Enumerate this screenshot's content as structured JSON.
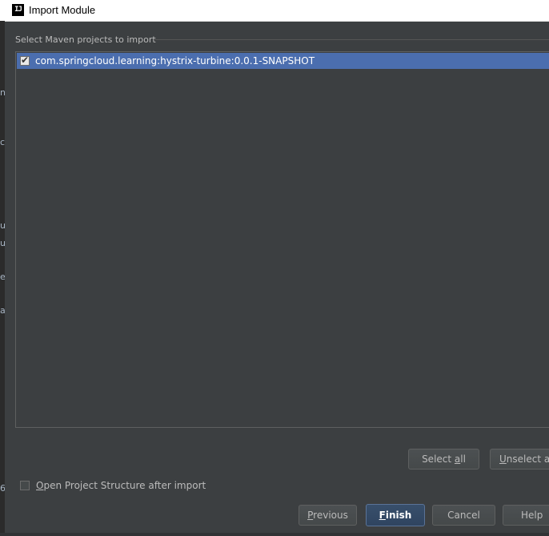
{
  "window": {
    "title": "Import Module",
    "app_icon_text": "IJ"
  },
  "background_fragments": [
    "ni",
    "c",
    "u",
    "u",
    "e",
    "al",
    "6"
  ],
  "section": {
    "title": "Select Maven projects to import"
  },
  "projects": [
    {
      "label": "com.springcloud.learning:hystrix-turbine:0.0.1-SNAPSHOT",
      "checked": true,
      "selected": true
    }
  ],
  "selection_buttons": {
    "select_all_pre": "Select ",
    "select_all_mnemonic": "a",
    "select_all_post": "ll",
    "unselect_all_mnemonic": "U",
    "unselect_all_post": "nselect al"
  },
  "options": {
    "open_structure_mnemonic": "O",
    "open_structure_rest": "pen Project Structure after import",
    "open_structure_checked": false
  },
  "footer": {
    "previous_mnemonic": "P",
    "previous_rest": "revious",
    "finish_mnemonic": "F",
    "finish_rest": "inish",
    "cancel_label": "Cancel",
    "help_label": "Help"
  },
  "colors": {
    "dialog_bg": "#3c3f41",
    "selection": "#4b6eaf",
    "default_button": "#2f4460"
  }
}
